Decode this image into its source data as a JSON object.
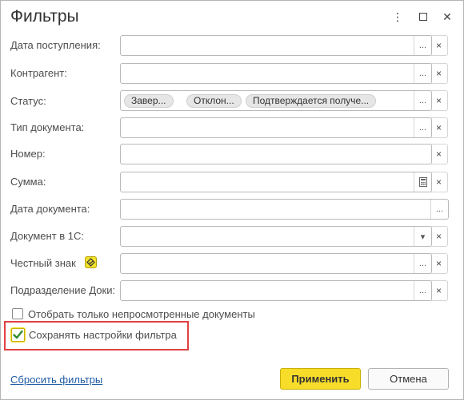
{
  "dialog": {
    "title": "Фильтры",
    "menu_icon": "⋮",
    "maximize_icon": "☐",
    "close_icon": "✕"
  },
  "fields": {
    "receipt_date": {
      "label": "Дата поступления:",
      "value": ""
    },
    "counterparty": {
      "label": "Контрагент:",
      "value": ""
    },
    "status": {
      "label": "Статус:",
      "chips": [
        "Завер...",
        "Отклон...",
        "Подтверждается получе..."
      ]
    },
    "doc_type": {
      "label": "Тип документа:",
      "value": ""
    },
    "number": {
      "label": "Номер:",
      "value": ""
    },
    "sum": {
      "label": "Сумма:",
      "value": ""
    },
    "doc_date": {
      "label": "Дата документа:",
      "value": ""
    },
    "doc_1c": {
      "label": "Документ в 1С:",
      "value": ""
    },
    "honest_sign": {
      "label": "Честный знак",
      "value": ""
    },
    "doki_unit": {
      "label": "Подразделение Доки:",
      "value": ""
    }
  },
  "buttons_glyphs": {
    "ellipsis": "...",
    "clear": "×",
    "dropdown": "▾"
  },
  "checkboxes": {
    "unviewed_only": {
      "label": "Отобрать только непросмотренные документы",
      "checked": false
    },
    "save_settings": {
      "label": "Сохранять настройки фильтра",
      "checked": true
    }
  },
  "footer": {
    "reset_link": "Сбросить фильтры",
    "apply_label": "Применить",
    "cancel_label": "Отмена"
  },
  "colors": {
    "primary_button": "#f7dd2a",
    "link": "#1f5da6",
    "highlight": "#e14141",
    "check": "#2e8b2e"
  }
}
